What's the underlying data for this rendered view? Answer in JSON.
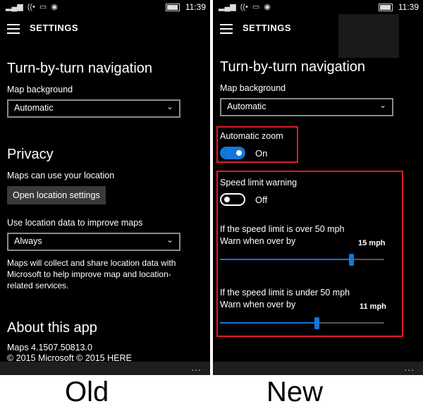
{
  "status": {
    "time": "11:39"
  },
  "header": {
    "title": "SETTINGS"
  },
  "old": {
    "nav_title": "Turn-by-turn navigation",
    "map_bg_label": "Map background",
    "map_bg_value": "Automatic",
    "privacy_title": "Privacy",
    "location_text": "Maps can use your location",
    "location_button": "Open location settings",
    "improve_label": "Use location data to improve maps",
    "improve_value": "Always",
    "improve_desc": "Maps will collect and share location data with Microsoft to help improve map and location-related services.",
    "about_title": "About this app",
    "version": "Maps 4.1507.50813.0",
    "copyright": "© 2015 Microsoft © 2015 HERE"
  },
  "new": {
    "nav_title": "Turn-by-turn navigation",
    "map_bg_label": "Map background",
    "map_bg_value": "Automatic",
    "auto_zoom_label": "Automatic zoom",
    "auto_zoom_state": "On",
    "speed_warning_label": "Speed limit warning",
    "speed_warning_state": "Off",
    "over_line1": "If the speed limit is over 50 mph",
    "over_line2": "Warn when over by",
    "over_value": "15 mph",
    "over_fraction": 0.8,
    "under_line1": "If the speed limit is under 50 mph",
    "under_line2": "Warn when over by",
    "under_value": "11 mph",
    "under_fraction": 0.59
  },
  "captions": {
    "old": "Old",
    "new": "New"
  },
  "more_dots": "...",
  "colors": {
    "accent": "#1476d6",
    "highlight": "#e11a2a",
    "background": "#000000"
  }
}
